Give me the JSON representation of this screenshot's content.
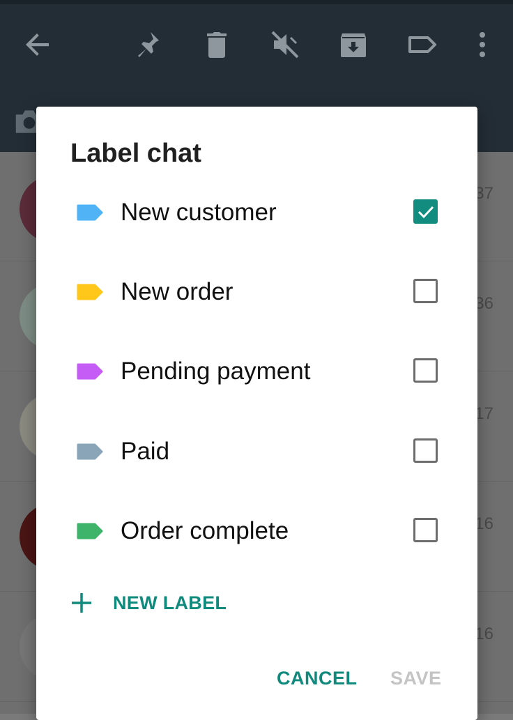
{
  "appbar": {
    "icons": [
      "back-arrow-icon",
      "pin-icon",
      "delete-icon",
      "mute-icon",
      "archive-icon",
      "label-icon",
      "more-vert-icon"
    ]
  },
  "background_chats": {
    "times": [
      "37",
      "36",
      "17",
      "16",
      "16"
    ]
  },
  "dialog": {
    "title": "Label chat",
    "labels": [
      {
        "name": "New customer",
        "color": "#4fb3f6",
        "checked": true
      },
      {
        "name": "New order",
        "color": "#ffc719",
        "checked": false
      },
      {
        "name": "Pending payment",
        "color": "#c65cf6",
        "checked": false
      },
      {
        "name": "Paid",
        "color": "#8aa5b7",
        "checked": false
      },
      {
        "name": "Order complete",
        "color": "#3eb36a",
        "checked": false
      }
    ],
    "new_label": "NEW LABEL",
    "cancel": "CANCEL",
    "save": "SAVE"
  },
  "colors": {
    "accent": "#128c7e",
    "appbar": "#232d36",
    "disabled": "#c4c4c4"
  }
}
